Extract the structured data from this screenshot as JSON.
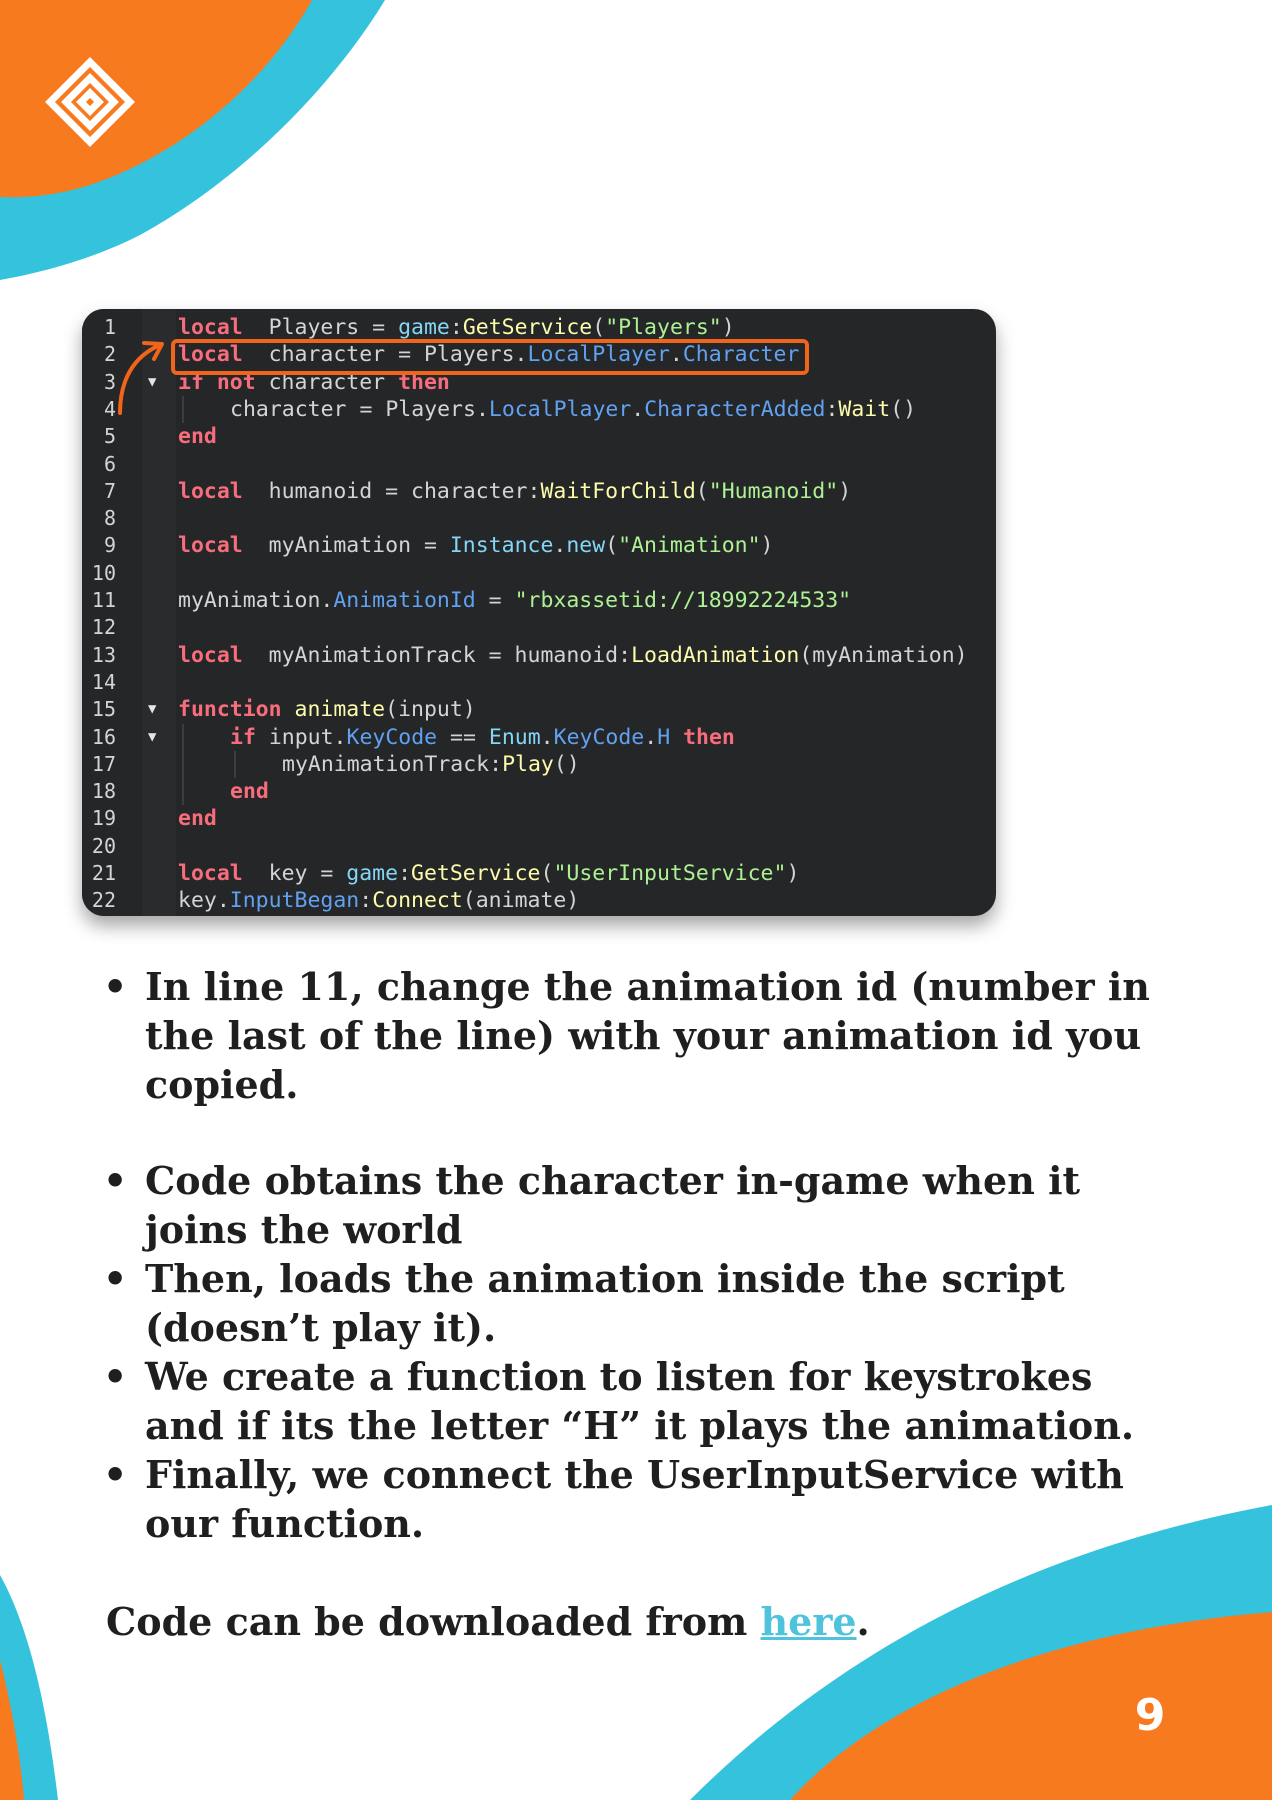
{
  "colors": {
    "orange": "#f87a1f",
    "cyan": "#34c2dd",
    "link": "#4ec3db",
    "editor_bg": "#252627",
    "highlight": "#f1641c"
  },
  "logo": {
    "icon": "nested-diamond-logo-icon"
  },
  "code": {
    "lines": [
      {
        "n": "1",
        "fold": "",
        "indent": 0,
        "tokens": [
          [
            "kw",
            "local"
          ],
          [
            "",
            "  Players = "
          ],
          [
            "svc",
            "game"
          ],
          [
            "",
            ":"
          ],
          [
            "fn",
            "GetService"
          ],
          [
            "",
            "("
          ],
          [
            "str",
            "\"Players\""
          ],
          [
            "",
            ")"
          ]
        ]
      },
      {
        "n": "2",
        "fold": "",
        "indent": 0,
        "tokens": [
          [
            "kw",
            "local"
          ],
          [
            "",
            "  character = Players."
          ],
          [
            "prop",
            "LocalPlayer"
          ],
          [
            "",
            "."
          ],
          [
            "prop",
            "Character"
          ]
        ]
      },
      {
        "n": "3",
        "fold": "▼",
        "indent": 0,
        "tokens": [
          [
            "kw",
            "if not"
          ],
          [
            "",
            " character "
          ],
          [
            "kw",
            "then"
          ]
        ]
      },
      {
        "n": "4",
        "fold": "",
        "indent": 1,
        "tokens": [
          [
            "",
            "character = Players."
          ],
          [
            "prop",
            "LocalPlayer"
          ],
          [
            "",
            "."
          ],
          [
            "prop",
            "CharacterAdded"
          ],
          [
            "",
            ":"
          ],
          [
            "fn",
            "Wait"
          ],
          [
            "",
            "()"
          ]
        ]
      },
      {
        "n": "5",
        "fold": "",
        "indent": 0,
        "tokens": [
          [
            "kw",
            "end"
          ]
        ]
      },
      {
        "n": "6",
        "fold": "",
        "indent": 0,
        "tokens": []
      },
      {
        "n": "7",
        "fold": "",
        "indent": 0,
        "tokens": [
          [
            "kw",
            "local"
          ],
          [
            "",
            "  humanoid = character:"
          ],
          [
            "fn",
            "WaitForChild"
          ],
          [
            "",
            "("
          ],
          [
            "str",
            "\"Humanoid\""
          ],
          [
            "",
            ")"
          ]
        ]
      },
      {
        "n": "8",
        "fold": "",
        "indent": 0,
        "tokens": []
      },
      {
        "n": "9",
        "fold": "",
        "indent": 0,
        "tokens": [
          [
            "kw",
            "local"
          ],
          [
            "",
            "  myAnimation = "
          ],
          [
            "svc",
            "Instance"
          ],
          [
            "",
            "."
          ],
          [
            "svc",
            "new"
          ],
          [
            "",
            "("
          ],
          [
            "str",
            "\"Animation\""
          ],
          [
            "",
            ")"
          ]
        ]
      },
      {
        "n": "10",
        "fold": "",
        "indent": 0,
        "tokens": []
      },
      {
        "n": "11",
        "fold": "",
        "indent": 0,
        "tokens": [
          [
            "",
            "myAnimation."
          ],
          [
            "prop",
            "AnimationId"
          ],
          [
            "",
            " = "
          ],
          [
            "str",
            "\"rbxassetid://18992224533\""
          ]
        ]
      },
      {
        "n": "12",
        "fold": "",
        "indent": 0,
        "tokens": []
      },
      {
        "n": "13",
        "fold": "",
        "indent": 0,
        "tokens": [
          [
            "kw",
            "local"
          ],
          [
            "",
            "  myAnimationTrack = humanoid:"
          ],
          [
            "fn",
            "LoadAnimation"
          ],
          [
            "",
            "(myAnimation)"
          ]
        ]
      },
      {
        "n": "14",
        "fold": "",
        "indent": 0,
        "tokens": []
      },
      {
        "n": "15",
        "fold": "▼",
        "indent": 0,
        "tokens": [
          [
            "kw",
            "function"
          ],
          [
            "",
            " "
          ],
          [
            "fn",
            "animate"
          ],
          [
            "",
            "(input)"
          ]
        ]
      },
      {
        "n": "16",
        "fold": "▼",
        "indent": 1,
        "tokens": [
          [
            "kw",
            "if"
          ],
          [
            "",
            " input."
          ],
          [
            "prop",
            "KeyCode"
          ],
          [
            "",
            " == "
          ],
          [
            "svc",
            "Enum"
          ],
          [
            "",
            "."
          ],
          [
            "prop",
            "KeyCode"
          ],
          [
            "",
            "."
          ],
          [
            "prop",
            "H"
          ],
          [
            "",
            " "
          ],
          [
            "kw",
            "then"
          ]
        ]
      },
      {
        "n": "17",
        "fold": "",
        "indent": 2,
        "tokens": [
          [
            "",
            "myAnimationTrack:"
          ],
          [
            "fn",
            "Play"
          ],
          [
            "",
            "()"
          ]
        ]
      },
      {
        "n": "18",
        "fold": "",
        "indent": 1,
        "tokens": [
          [
            "kw",
            "end"
          ]
        ]
      },
      {
        "n": "19",
        "fold": "",
        "indent": 0,
        "tokens": [
          [
            "kw",
            "end"
          ]
        ]
      },
      {
        "n": "20",
        "fold": "",
        "indent": 0,
        "tokens": []
      },
      {
        "n": "21",
        "fold": "",
        "indent": 0,
        "tokens": [
          [
            "kw",
            "local"
          ],
          [
            "",
            "  key = "
          ],
          [
            "svc",
            "game"
          ],
          [
            "",
            ":"
          ],
          [
            "fn",
            "GetService"
          ],
          [
            "",
            "("
          ],
          [
            "str",
            "\"UserInputService\""
          ],
          [
            "",
            ")"
          ]
        ]
      },
      {
        "n": "22",
        "fold": "",
        "indent": 0,
        "tokens": [
          [
            "",
            "key."
          ],
          [
            "prop",
            "InputBegan"
          ],
          [
            "",
            ":"
          ],
          [
            "fn",
            "Connect"
          ],
          [
            "",
            "(animate)"
          ]
        ]
      }
    ]
  },
  "instructions": {
    "bullets": [
      "In line 11, change the animation id (number in the last of the line) with your animation id you copied."
    ]
  },
  "explanation": {
    "bullets": [
      "Code obtains the character in-game when it joins the world",
      "Then, loads the animation inside the script (doesn’t play it).",
      "We create a function to listen for keystrokes and if its the letter “H” it plays the animation.",
      "Finally, we connect the UserInputService with our function."
    ]
  },
  "download": {
    "prefix": "Code can be downloaded from ",
    "link": "here",
    "suffix": "."
  },
  "page": {
    "number": "9"
  }
}
